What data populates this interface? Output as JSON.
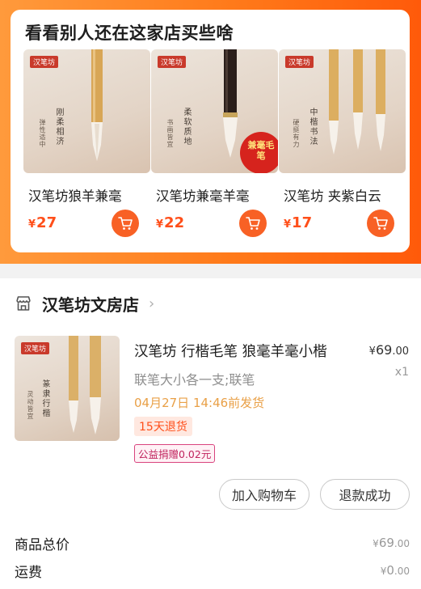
{
  "recommend": {
    "title": "看看别人还在这家店买些啥",
    "products": [
      {
        "name": "汉笔坊狼羊兼毫",
        "currency": "¥",
        "price": "27",
        "seal": "汉笔坊",
        "calli_main": "刚柔相济",
        "calli_side": "弹性适中"
      },
      {
        "name": "汉笔坊兼毫羊毫",
        "currency": "¥",
        "price": "22",
        "seal": "汉笔坊",
        "calli_main": "柔软质地",
        "calli_side": "书画皆宜",
        "badge": "兼毫毛笔"
      },
      {
        "name": "汉笔坊 夹紫白云",
        "currency": "¥",
        "price": "17",
        "seal": "汉笔坊",
        "calli_main": "中楷书法",
        "calli_side": "硬挺有力"
      }
    ]
  },
  "shop": {
    "name": "汉笔坊文房店"
  },
  "order": {
    "title": "汉笔坊 行楷毛笔 狼毫羊毫小楷",
    "currency": "¥",
    "price_int": "69",
    "price_dec": ".00",
    "spec": "联笔大小各一支;联笔",
    "qty": "x1",
    "ship": "04月27日 14:46前发货",
    "return_tag": "15天退货",
    "charity_tag": "公益捐赠0.02元",
    "seal": "汉笔坊",
    "calli_main": "篆隶行楷",
    "calli_side": "灵动皆宜",
    "btn_cart": "加入购物车",
    "btn_refund": "退款成功"
  },
  "summary": {
    "total_label": "商品总价",
    "total_currency": "¥",
    "total_int": "69",
    "total_dec": ".00",
    "shipping_label": "运费",
    "shipping_currency": "¥",
    "shipping_int": "0",
    "shipping_dec": ".00"
  },
  "colors": {
    "accent": "#ff4f1a",
    "cart_button": "#f86125",
    "ship_text": "#e9a047",
    "charity": "#c0245e"
  },
  "icons": [
    "cart-icon",
    "shop-icon",
    "chevron-right-icon"
  ]
}
